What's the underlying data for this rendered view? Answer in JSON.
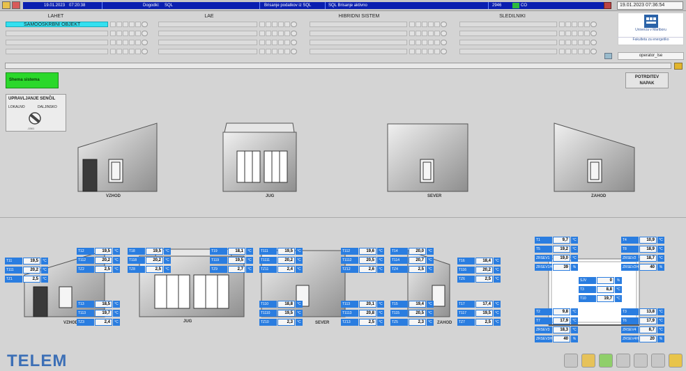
{
  "topbar": {
    "date": "19.01.2023",
    "time": "07:20:38",
    "dogodki": "Dogodki:",
    "sql": "SQL",
    "brisanje": "Brisanje podatkov iz SQL",
    "sql_brisanje": "SQL Brisanje aktivno",
    "count": "2946",
    "co": "CO",
    "datetime_right": "19.01.2023 07:36:54"
  },
  "groups": {
    "lahet": "LAHET",
    "lae": "LAE",
    "hibridni": "HIBRIDNI SISTEM",
    "sledilniki": "SLEDILNIKI",
    "samo": "SAMOOSKRBNI OBJEKT"
  },
  "logo": {
    "university": "Univerza v Mariboru",
    "faculty": "Fakulteta za energetiko"
  },
  "operator": "operator_lse",
  "buttons": {
    "shema": "Shema sistema",
    "potrdi_line1": "POTRDITEV",
    "potrdi_line2": "NAPAK"
  },
  "sencila": {
    "title": "UPRAVLJANJE SENČIL",
    "lokalno": "LOKALNO",
    "daljinsko": "DALJINSKO",
    "value": "-1561"
  },
  "facades": [
    "VZHOD",
    "JUG",
    "SEVER",
    "ZAHOD"
  ],
  "bottom_labels": [
    "VZHOD",
    "JUG",
    "SEVER",
    "ZAHOD"
  ],
  "readings": {
    "vz_l": [
      {
        "l": "T11",
        "v": "19,5",
        "u": "°C"
      },
      {
        "l": "T111",
        "v": "20,2",
        "u": "°C"
      },
      {
        "l": "TZ1",
        "v": "2,5",
        "u": "°C"
      }
    ],
    "vz_t": [
      {
        "l": "T12",
        "v": "19,5",
        "u": "°C"
      },
      {
        "l": "T112",
        "v": "20,2",
        "u": "°C"
      },
      {
        "l": "TZ2",
        "v": "2,5",
        "u": "°C"
      }
    ],
    "vz_b": [
      {
        "l": "T13",
        "v": "18,5",
        "u": "°C"
      },
      {
        "l": "T113",
        "v": "19,7",
        "u": "°C"
      },
      {
        "l": "TZ3",
        "v": "2,4",
        "u": "°C"
      }
    ],
    "jug_l": [
      {
        "l": "T18",
        "v": "19,5",
        "u": "°C"
      },
      {
        "l": "T118",
        "v": "20,2",
        "u": "°C"
      },
      {
        "l": "TZ8",
        "v": "2,5",
        "u": "°C"
      }
    ],
    "jug_r": [
      {
        "l": "T19",
        "v": "18,1",
        "u": "°C"
      },
      {
        "l": "T119",
        "v": "19,5",
        "u": "°C"
      },
      {
        "l": "TZ9",
        "v": "2,7",
        "u": "°C"
      }
    ],
    "sev_lt": [
      {
        "l": "T111",
        "v": "19,5",
        "u": "°C"
      },
      {
        "l": "T1111",
        "v": "20,2",
        "u": "°C"
      },
      {
        "l": "TZ11",
        "v": "2,4",
        "u": "°C"
      }
    ],
    "sev_rt": [
      {
        "l": "T112",
        "v": "19,6",
        "u": "°C"
      },
      {
        "l": "T1112",
        "v": "20,5",
        "u": "°C"
      },
      {
        "l": "TZ12",
        "v": "2,6",
        "u": "°C"
      }
    ],
    "sev_lb": [
      {
        "l": "T110",
        "v": "18,8",
        "u": "°C"
      },
      {
        "l": "T1110",
        "v": "19,5",
        "u": "°C"
      },
      {
        "l": "TZ10",
        "v": "2,3",
        "u": "°C"
      }
    ],
    "sev_rb": [
      {
        "l": "T113",
        "v": "20,1",
        "u": "°C"
      },
      {
        "l": "T1113",
        "v": "20,8",
        "u": "°C"
      },
      {
        "l": "TZ13",
        "v": "2,5",
        "u": "°C"
      }
    ],
    "zah_lt": [
      {
        "l": "T14",
        "v": "20,0",
        "u": "°C"
      },
      {
        "l": "T114",
        "v": "20,7",
        "u": "°C"
      },
      {
        "l": "TZ4",
        "v": "2,5",
        "u": "°C"
      }
    ],
    "zah_rt": [
      {
        "l": "T16",
        "v": "18,4",
        "u": "°C"
      },
      {
        "l": "T116",
        "v": "20,2",
        "u": "°C"
      },
      {
        "l": "TZ6",
        "v": "2,5",
        "u": "°C"
      }
    ],
    "zah_lb": [
      {
        "l": "T15",
        "v": "19,4",
        "u": "°C"
      },
      {
        "l": "T115",
        "v": "20,5",
        "u": "°C"
      },
      {
        "l": "TZ5",
        "v": "2,3",
        "u": "°C"
      }
    ],
    "zah_rb": [
      {
        "l": "T17",
        "v": "17,4",
        "u": "°C"
      },
      {
        "l": "T117",
        "v": "19,5",
        "u": "°C"
      },
      {
        "l": "TZ7",
        "v": "2,5",
        "u": "°C"
      }
    ],
    "roof_lt": [
      {
        "l": "T1",
        "v": "9,7",
        "u": "°C"
      },
      {
        "l": "T5",
        "v": "19,2",
        "u": "°C"
      },
      {
        "l": "ZRSEV1",
        "v": "19,0",
        "u": "°C"
      },
      {
        "l": "ZRSEV1H",
        "v": "39",
        "u": "%"
      }
    ],
    "roof_rt": [
      {
        "l": "T4",
        "v": "10,9",
        "u": "°C"
      },
      {
        "l": "T8",
        "v": "18,9",
        "u": "°C"
      },
      {
        "l": "ZRSEV2",
        "v": "18,7",
        "u": "°C"
      },
      {
        "l": "ZRSEV2H",
        "v": "40",
        "u": "%"
      }
    ],
    "roof_c": [
      {
        "l": "SJV",
        "v": "0",
        "u": "%"
      },
      {
        "l": "T3",
        "v": "8,8",
        "u": "°C"
      },
      {
        "l": "T10",
        "v": "19,7",
        "u": "°C"
      }
    ],
    "roof_lb": [
      {
        "l": "T2",
        "v": "9,8",
        "u": "°C"
      },
      {
        "l": "T7",
        "v": "17,9",
        "u": "°C"
      },
      {
        "l": "ZRSEV3",
        "v": "18,3",
        "u": "°C"
      },
      {
        "l": "ZRSEV3H",
        "v": "40",
        "u": "%"
      }
    ],
    "roof_rb": [
      {
        "l": "T3",
        "v": "13,8",
        "u": "°C"
      },
      {
        "l": "T6",
        "v": "17,9",
        "u": "°C"
      },
      {
        "l": "ZRSEV4",
        "v": "8,7",
        "u": "°C"
      },
      {
        "l": "ZRSEV4H",
        "v": "20",
        "u": "%"
      }
    ]
  },
  "brand": "TELEM"
}
